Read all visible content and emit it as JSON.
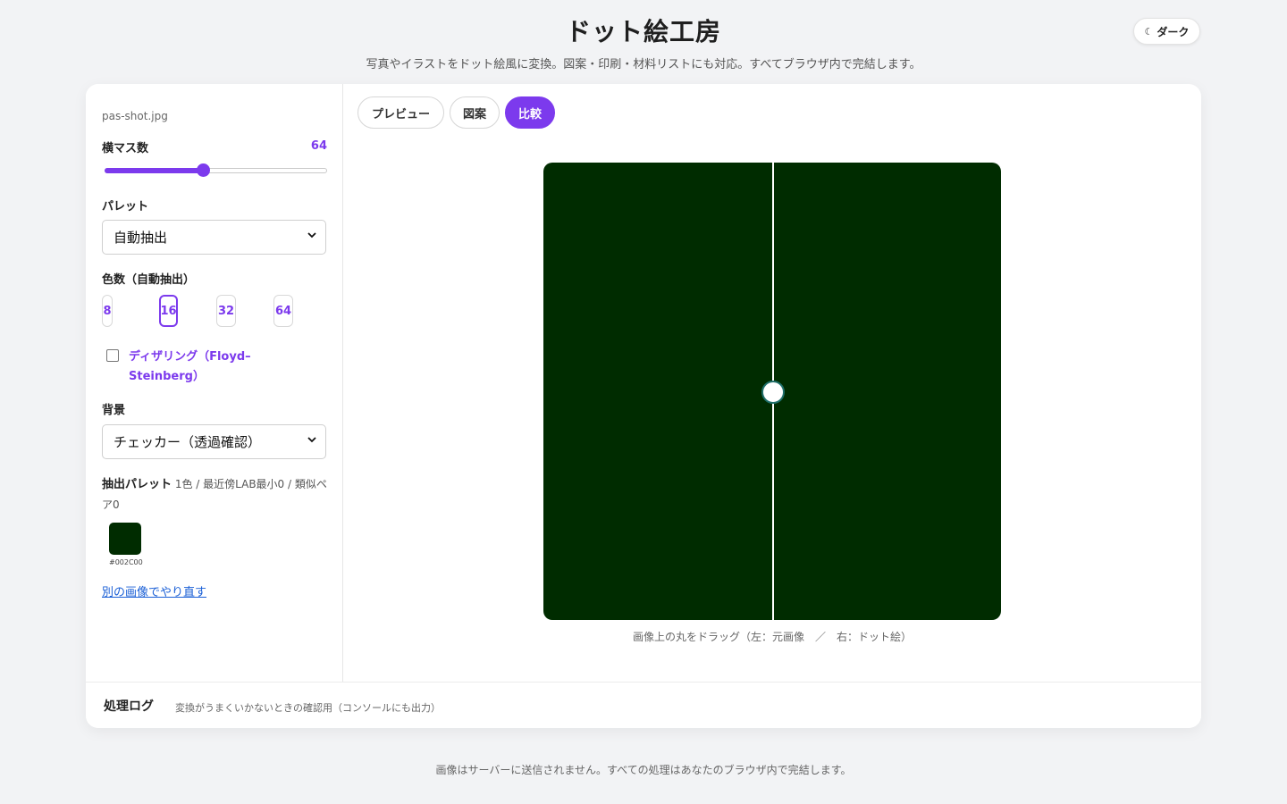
{
  "header": {
    "title": "ドット絵工房",
    "subtitle": "写真やイラストをドット絵風に変換。図案・印刷・材料リストにも対応。すべてブラウザ内で完結します。",
    "dark_toggle": {
      "icon": "moon-icon",
      "label": "ダーク"
    }
  },
  "sidebar": {
    "filename": "pas-shot.jpg",
    "width_label": "横マス数",
    "width_value": "64",
    "width_slider_fraction": 0.44,
    "palette_label": "パレット",
    "palette_value": "自動抽出",
    "colors_label": "色数（自動抽出）",
    "color_options": [
      "8",
      "16",
      "32",
      "64"
    ],
    "color_selected": "16",
    "dither_checked": false,
    "dither_label": "ディザリング（Floyd–Steinberg）",
    "background_label": "背景",
    "background_value": "チェッカー（透過確認）",
    "extracted_palette_title": "抽出パレット",
    "extracted_palette_stats": "1色 / 最近傍LAB最小0 / 類似ペア0",
    "swatches": [
      {
        "color": "#002c00",
        "label": "#002C00"
      }
    ],
    "retry_link": "別の画像でやり直す"
  },
  "main": {
    "tabs": [
      {
        "label": "プレビュー",
        "active": false
      },
      {
        "label": "図案",
        "active": false
      },
      {
        "label": "比較",
        "active": true
      }
    ],
    "compare_caption": "画像上の丸をドラッグ（左：元画像　／　右：ドット絵）",
    "compare_color": "#002c00"
  },
  "log": {
    "title": "処理ログ",
    "description": "変換がうまくいかないときの確認用（コンソールにも出力）"
  },
  "footer": "画像はサーバーに送信されません。すべての処理はあなたのブラウザ内で完結します。",
  "colors": {
    "accent": "#7c3aed",
    "link": "#1a5fd6",
    "background": "#f2f3f5"
  }
}
